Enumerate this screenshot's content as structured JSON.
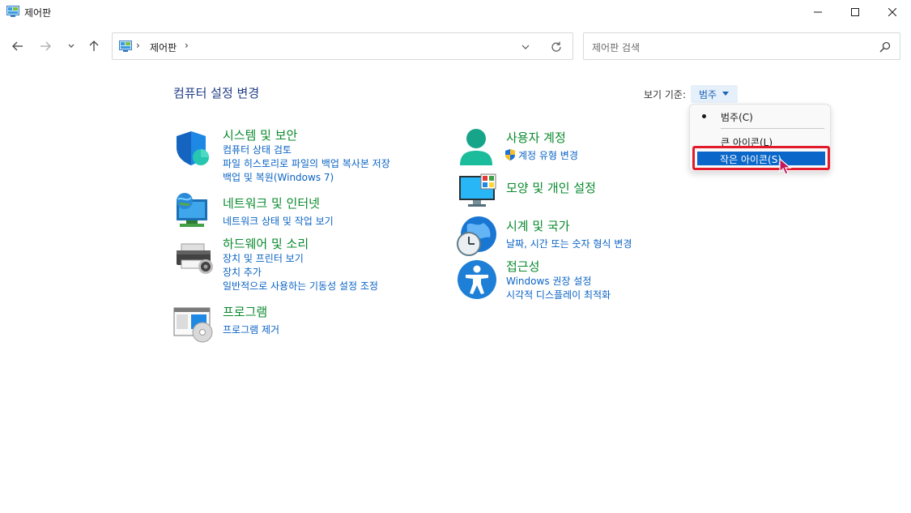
{
  "window": {
    "title": "제어판"
  },
  "address": {
    "separator": "›",
    "path_label": "제어판"
  },
  "search": {
    "placeholder": "제어판 검색"
  },
  "main": {
    "title": "컴퓨터 설정 변경",
    "view_by_label": "보기 기준:",
    "view_by_value": "범주"
  },
  "categories": [
    {
      "title": "시스템 및 보안",
      "icon": "shield-icon",
      "links": [
        "컴퓨터 상태 검토",
        "파일 히스토리로 파일의 백업 복사본 저장",
        "백업 및 복원(Windows 7)"
      ]
    },
    {
      "title": "네트워크 및 인터넷",
      "icon": "network-icon",
      "links": [
        "네트워크 상태 및 작업 보기"
      ]
    },
    {
      "title": "하드웨어 및 소리",
      "icon": "printer-icon",
      "links": [
        "장치 및 프린터 보기",
        "장치 추가",
        "일반적으로 사용하는 기동성 설정 조정"
      ]
    },
    {
      "title": "프로그램",
      "icon": "programs-icon",
      "links": [
        "프로그램 제거"
      ]
    },
    {
      "title": "사용자 계정",
      "icon": "user-icon",
      "links": [
        "계정 유형 변경"
      ]
    },
    {
      "title": "모양 및 개인 설정",
      "icon": "monitor-icon",
      "links": []
    },
    {
      "title": "시계 및 국가",
      "icon": "clock-globe-icon",
      "links": [
        "날짜, 시간 또는 숫자 형식 변경"
      ]
    },
    {
      "title": "접근성",
      "icon": "accessibility-icon",
      "links": [
        "Windows 권장 설정",
        "시각적 디스플레이 최적화"
      ]
    }
  ],
  "menu": {
    "items": [
      "범주(C)",
      "큰 아이콘(L)",
      "작은 아이콘(S)"
    ],
    "selected": "범주(C)",
    "highlighted": "작은 아이콘(S)"
  },
  "colors": {
    "category_title": "#0a8a2e",
    "link": "#0a63c4",
    "page_title": "#1f3c86",
    "highlight": "#0a67c9",
    "annotation_box": "#e21b2b"
  }
}
